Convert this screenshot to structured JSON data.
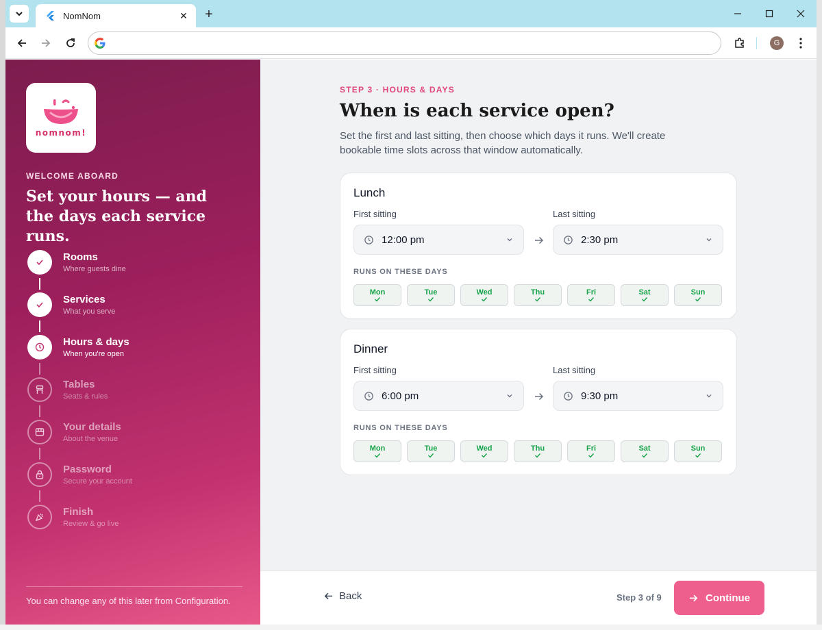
{
  "browser": {
    "tab_title": "NomNom",
    "new_tab": "+",
    "tab_close": "✕",
    "profile_initial": "G",
    "address": ""
  },
  "logo": {
    "text": "nomnom!"
  },
  "sidebar": {
    "eyebrow": "WELCOME ABOARD",
    "headline": "Set your hours — and the days each service runs.",
    "steps": [
      {
        "label": "Rooms",
        "sub": "Where guests dine",
        "state": "done",
        "icon": "check-icon"
      },
      {
        "label": "Services",
        "sub": "What you serve",
        "state": "done",
        "icon": "check-icon"
      },
      {
        "label": "Hours & days",
        "sub": "When you're open",
        "state": "current",
        "icon": "clock-icon"
      },
      {
        "label": "Tables",
        "sub": "Seats & rules",
        "state": "todo",
        "icon": "chair-icon"
      },
      {
        "label": "Your details",
        "sub": "About the venue",
        "state": "todo",
        "icon": "store-icon"
      },
      {
        "label": "Password",
        "sub": "Secure your account",
        "state": "todo",
        "icon": "lock-icon"
      },
      {
        "label": "Finish",
        "sub": "Review & go live",
        "state": "todo",
        "icon": "party-icon"
      }
    ],
    "footer_note": "You can change any of this later from Configuration."
  },
  "main": {
    "eyebrow": "STEP 3 · HOURS & DAYS",
    "heading": "When is each service open?",
    "description": "Set the first and last sitting, then choose which days it runs. We'll create bookable time slots across that window automatically.",
    "first_label": "First sitting",
    "last_label": "Last sitting",
    "days_label": "RUNS ON THESE DAYS",
    "services": [
      {
        "name": "Lunch",
        "first": "12:00 pm",
        "last": "2:30 pm",
        "days": [
          {
            "name": "Mon",
            "selected": true
          },
          {
            "name": "Tue",
            "selected": true
          },
          {
            "name": "Wed",
            "selected": true
          },
          {
            "name": "Thu",
            "selected": true
          },
          {
            "name": "Fri",
            "selected": true
          },
          {
            "name": "Sat",
            "selected": true
          },
          {
            "name": "Sun",
            "selected": true
          }
        ]
      },
      {
        "name": "Dinner",
        "first": "6:00 pm",
        "last": "9:30 pm",
        "days": [
          {
            "name": "Mon",
            "selected": true
          },
          {
            "name": "Tue",
            "selected": true
          },
          {
            "name": "Wed",
            "selected": true
          },
          {
            "name": "Thu",
            "selected": true
          },
          {
            "name": "Fri",
            "selected": true
          },
          {
            "name": "Sat",
            "selected": true
          },
          {
            "name": "Sun",
            "selected": true
          }
        ]
      }
    ]
  },
  "footer": {
    "back_label": "Back",
    "step_count": "Step 3 of 9",
    "continue_label": "Continue"
  },
  "colors": {
    "accent": "#ef5f8e",
    "eyebrow": "#e0457b",
    "selected_day": "#16a34a",
    "sidebar_dark": "#7c1d4e",
    "sidebar_light": "#e8598a"
  }
}
